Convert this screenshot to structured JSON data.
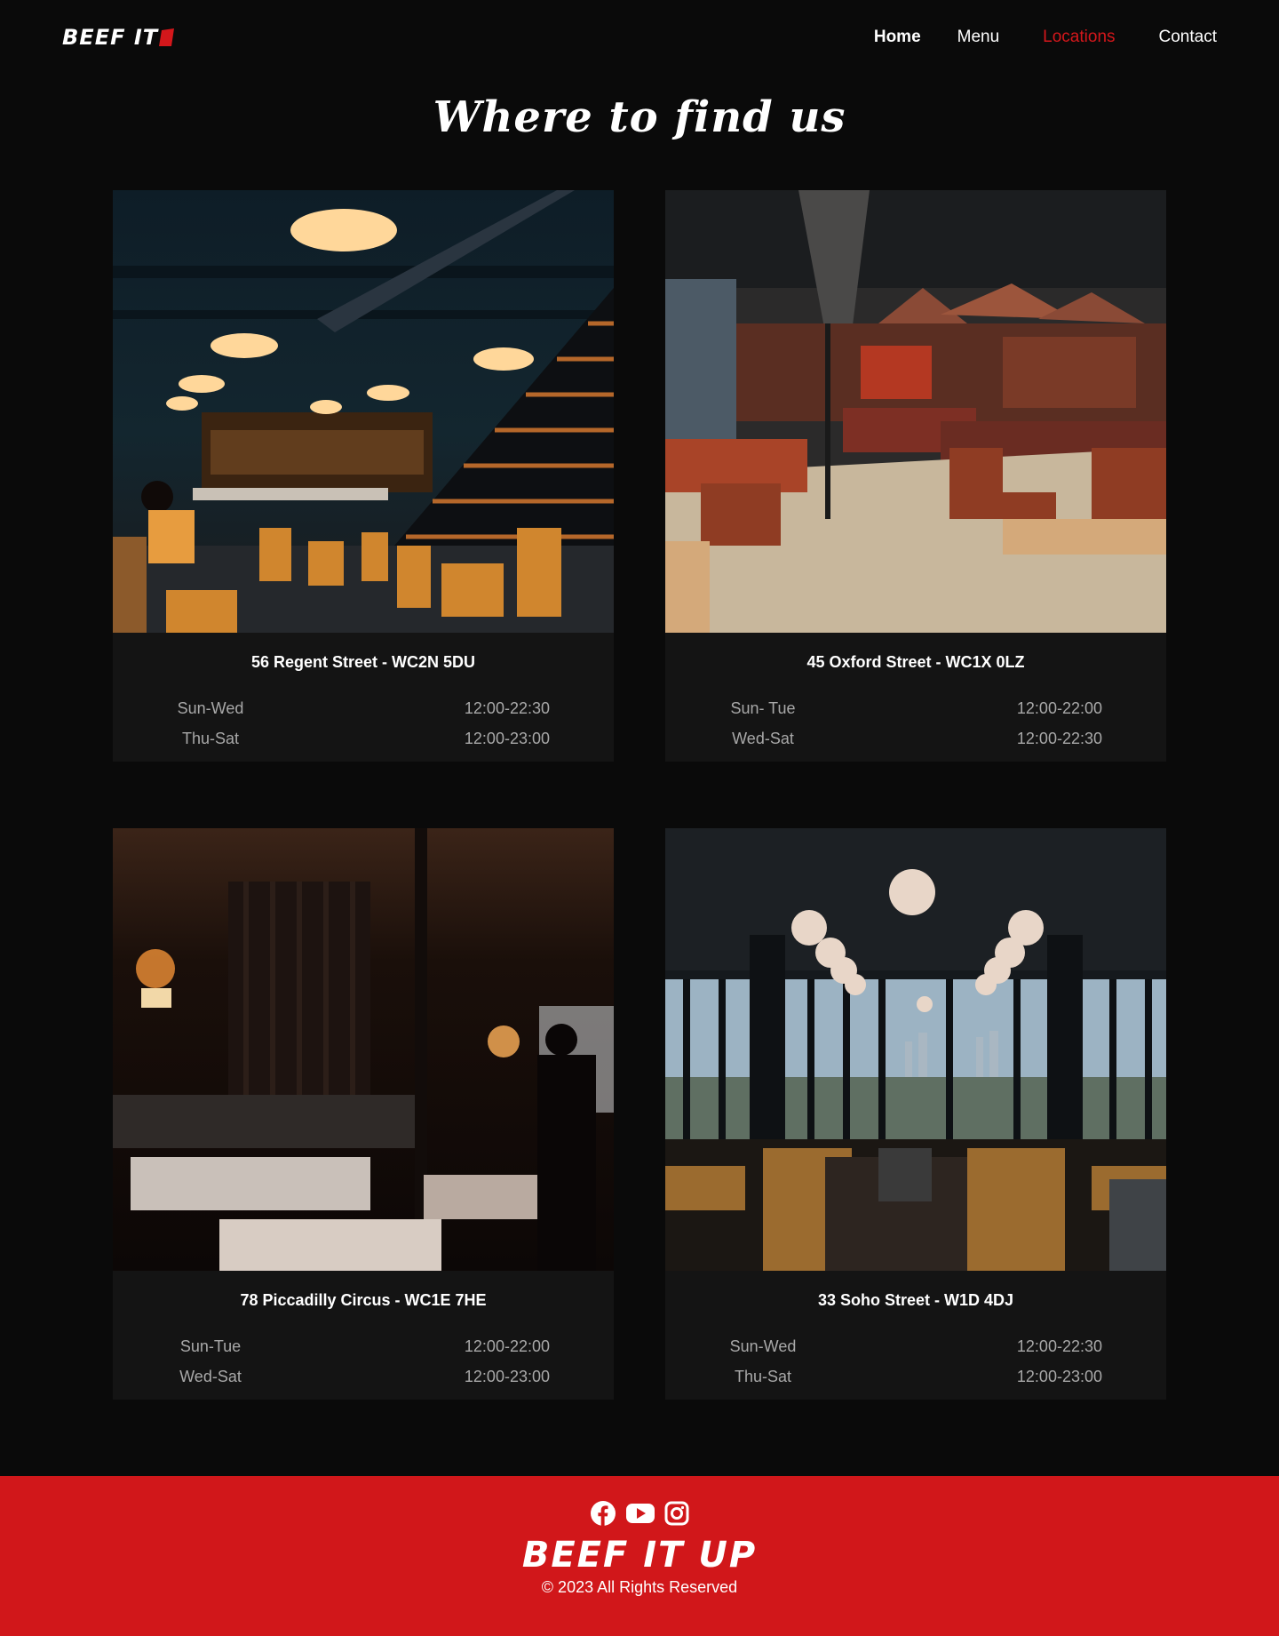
{
  "header": {
    "logo_text": "BEEF IT",
    "nav": {
      "home": "Home",
      "menu": "Menu",
      "locations": "Locations",
      "contact": "Contact"
    },
    "active_nav": "Locations"
  },
  "page_title": "Where to find us",
  "locations": [
    {
      "address": "56 Regent Street -  WC2N 5DU",
      "photo_icon": "restaurant-interior-photo",
      "hours": [
        {
          "days": "Sun-Wed",
          "time": "12:00-22:30"
        },
        {
          "days": "Thu-Sat",
          "time": "12:00-23:00"
        }
      ]
    },
    {
      "address": "45 Oxford Street -  WC1X 0LZ",
      "photo_icon": "restaurant-interior-photo",
      "hours": [
        {
          "days": "Sun- Tue",
          "time": "12:00-22:00"
        },
        {
          "days": "Wed-Sat",
          "time": "12:00-22:30"
        }
      ]
    },
    {
      "address": "78 Piccadilly Circus -  WC1E 7HE",
      "photo_icon": "restaurant-interior-photo",
      "hours": [
        {
          "days": "Sun-Tue",
          "time": "12:00-22:00"
        },
        {
          "days": "Wed-Sat",
          "time": "12:00-23:00"
        }
      ]
    },
    {
      "address": "33 Soho Street -  W1D 4DJ",
      "photo_icon": "restaurant-interior-photo",
      "hours": [
        {
          "days": "Sun-Wed",
          "time": "12:00-22:30"
        },
        {
          "days": "Thu-Sat",
          "time": "12:00-23:00"
        }
      ]
    }
  ],
  "footer": {
    "social_icons": [
      "facebook-icon",
      "youtube-icon",
      "instagram-icon"
    ],
    "brand": "BEEF IT UP",
    "copyright": "© 2023 All Rights Reserved"
  },
  "colors": {
    "background": "#0a0a0a",
    "card": "#141414",
    "accent_red": "#d4171b",
    "footer_red": "#d1171a",
    "muted_text": "#a8a8a8"
  }
}
